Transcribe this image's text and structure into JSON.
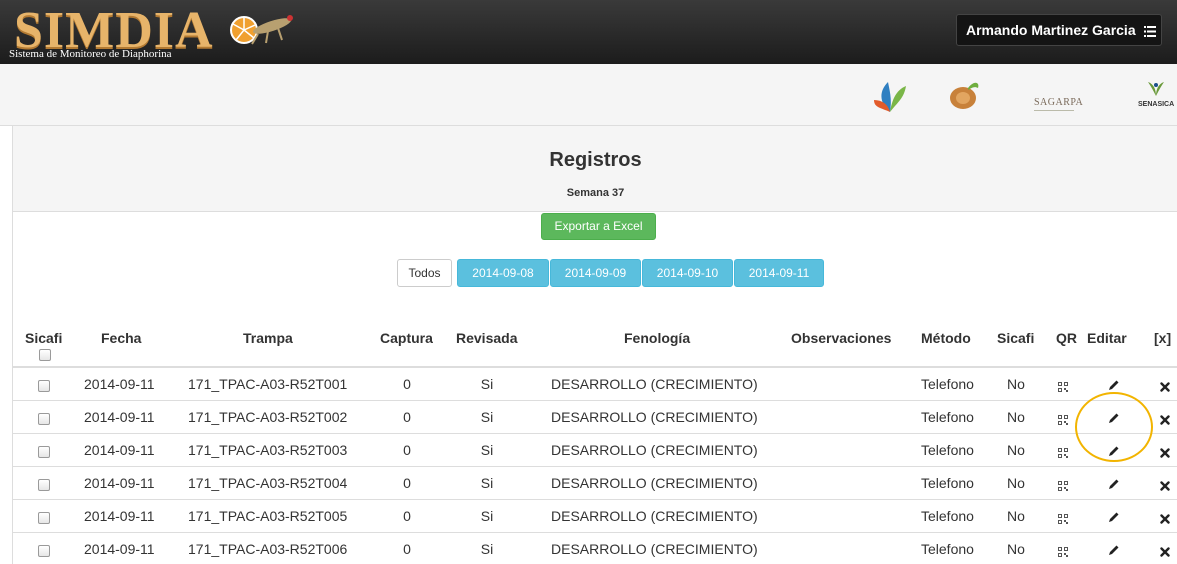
{
  "header": {
    "brand": "SIMDIA",
    "brand_subtitle": "Sistema de Monitoreo de Diaphorina",
    "user_name": "Armando Martinez Garcia",
    "user_menu_icon": "list-icon"
  },
  "logos": {
    "sagarpa": "SAGARPA",
    "senasica": "SENASICA"
  },
  "panel": {
    "title": "Registros",
    "week": "Semana 37",
    "export_label": "Exportar a Excel",
    "filters": [
      "Todos",
      "2014-09-08",
      "2014-09-09",
      "2014-09-10",
      "2014-09-11"
    ]
  },
  "table": {
    "columns": [
      "Sicafi",
      "Fecha",
      "Trampa",
      "Captura",
      "Revisada",
      "Fenología",
      "Observaciones",
      "Método",
      "Sicafi",
      "QR",
      "Editar",
      "[x]"
    ],
    "rows": [
      {
        "fecha": "2014-09-11",
        "trampa": "171_TPAC-A03-R52T001",
        "captura": "0",
        "revisada": "Si",
        "fenologia": "DESARROLLO (CRECIMIENTO)",
        "observaciones": "",
        "metodo": "Telefono",
        "sicafi": "No"
      },
      {
        "fecha": "2014-09-11",
        "trampa": "171_TPAC-A03-R52T002",
        "captura": "0",
        "revisada": "Si",
        "fenologia": "DESARROLLO (CRECIMIENTO)",
        "observaciones": "",
        "metodo": "Telefono",
        "sicafi": "No"
      },
      {
        "fecha": "2014-09-11",
        "trampa": "171_TPAC-A03-R52T003",
        "captura": "0",
        "revisada": "Si",
        "fenologia": "DESARROLLO (CRECIMIENTO)",
        "observaciones": "",
        "metodo": "Telefono",
        "sicafi": "No"
      },
      {
        "fecha": "2014-09-11",
        "trampa": "171_TPAC-A03-R52T004",
        "captura": "0",
        "revisada": "Si",
        "fenologia": "DESARROLLO (CRECIMIENTO)",
        "observaciones": "",
        "metodo": "Telefono",
        "sicafi": "No"
      },
      {
        "fecha": "2014-09-11",
        "trampa": "171_TPAC-A03-R52T005",
        "captura": "0",
        "revisada": "Si",
        "fenologia": "DESARROLLO (CRECIMIENTO)",
        "observaciones": "",
        "metodo": "Telefono",
        "sicafi": "No"
      },
      {
        "fecha": "2014-09-11",
        "trampa": "171_TPAC-A03-R52T006",
        "captura": "0",
        "revisada": "Si",
        "fenologia": "DESARROLLO (CRECIMIENTO)",
        "observaciones": "",
        "metodo": "Telefono",
        "sicafi": "No"
      }
    ]
  },
  "colors": {
    "navbar": "#222222",
    "brand": "#e7b46a",
    "export_button": "#5cb85c",
    "date_button": "#5bc0de",
    "highlight": "#f2b400"
  }
}
